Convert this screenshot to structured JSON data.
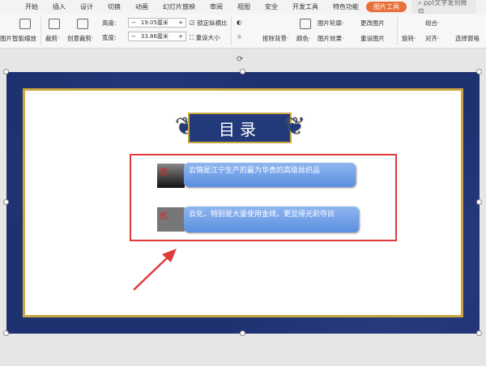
{
  "tabs": [
    "开始",
    "插入",
    "设计",
    "切换",
    "动画",
    "幻灯片放映",
    "审阅",
    "视图",
    "安全",
    "开发工具",
    "特色功能",
    "图片工具"
  ],
  "search_placeholder": "ppt文字发到微信",
  "ribbon": {
    "picture": "图片",
    "smart_zoom": "智能缩放",
    "crop": "裁剪·",
    "creative_crop": "创意裁剪·",
    "height_label": "高度:",
    "height_value": "19.05厘米",
    "width_label": "宽度:",
    "width_value": "33.86厘米",
    "lock_ratio": "锁定纵横比",
    "reset_size": "重设大小",
    "remove_bg": "抠除背景·",
    "color": "颜色·",
    "outline": "图片轮廓·",
    "effects": "图片效果·",
    "change_pic": "更改图片",
    "reset_pic": "重设图片",
    "rotate": "旋转·",
    "group": "组合·",
    "align": "对齐·",
    "selection_pane": "选择窗格",
    "minus": "−",
    "plus": "+"
  },
  "slide": {
    "title": "目录",
    "items": [
      {
        "num": "壹",
        "text": "云锦是江宁生产的最为华贵的高级丝织品"
      },
      {
        "num": "贰",
        "text": "云化，特别是大量使用金线，更显得光彩夺目"
      }
    ]
  },
  "colors": {
    "accent": "#e8703a",
    "navy": "#223a7a",
    "gold": "#c9a640",
    "annotation": "#e03a3a"
  }
}
